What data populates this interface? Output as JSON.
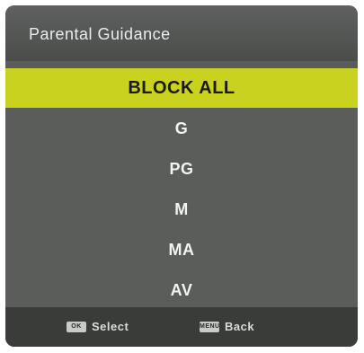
{
  "header": {
    "title": "Parental Guidance"
  },
  "menu": {
    "items": [
      {
        "label": "BLOCK ALL"
      },
      {
        "label": "G"
      },
      {
        "label": "PG"
      },
      {
        "label": "M"
      },
      {
        "label": "MA"
      },
      {
        "label": "AV"
      }
    ]
  },
  "footer": {
    "select": {
      "key": "OK",
      "label": "Select"
    },
    "back": {
      "key": "MENU",
      "label": "Back"
    }
  },
  "colors": {
    "panel": "#5a5c5a",
    "selected": "#c9d21e",
    "footer": "#3a3c3a"
  }
}
